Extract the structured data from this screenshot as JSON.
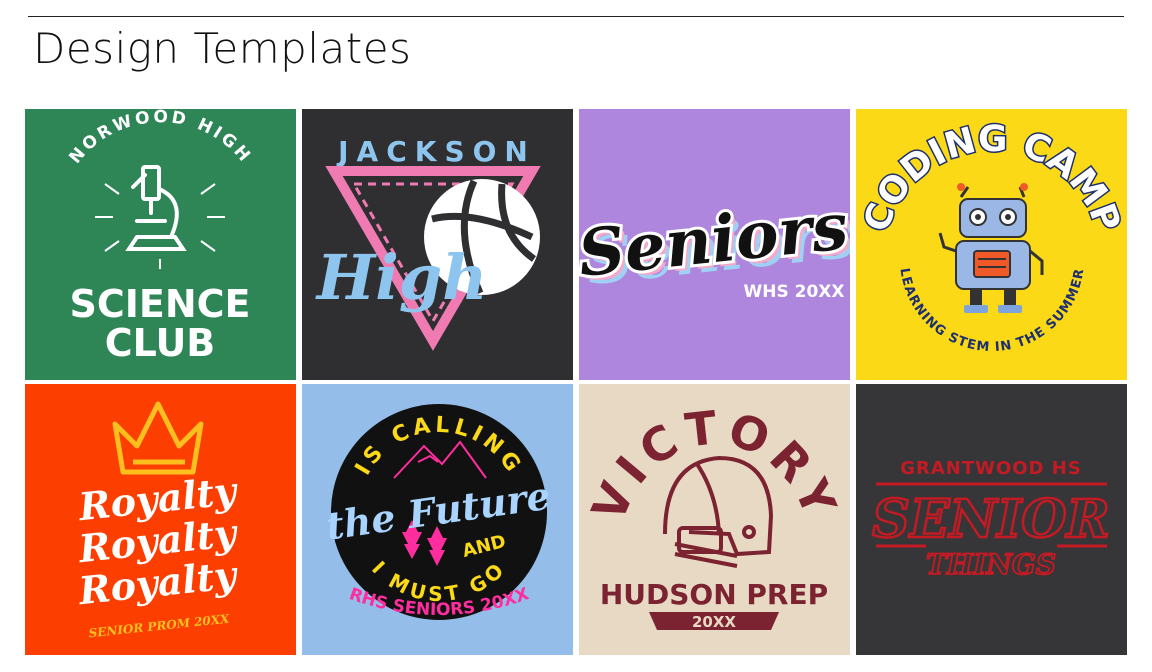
{
  "header": {
    "title": "Design Templates"
  },
  "templates": [
    {
      "name": "Science Club",
      "bg": "#2e8556",
      "arc": "NORWOOD HIGH",
      "line1": "SCIENCE",
      "line2": "CLUB"
    },
    {
      "name": "Jackson High Volleyball",
      "bg": "#2f2f31",
      "top": "JACKSON",
      "script": "High",
      "accent": "#f07bb2",
      "script_color": "#8ec5ee"
    },
    {
      "name": "Seniors",
      "bg": "#ae86dd",
      "script": "Seniors",
      "sub": "WHS 20XX"
    },
    {
      "name": "Coding Camp",
      "bg": "#fcd917",
      "arc_top": "CODING CAMP",
      "arc_bottom": "LEARNING STEM IN THE SUMMER"
    },
    {
      "name": "Royalty",
      "bg": "#fc3e00",
      "word": "Royalty",
      "sub": "SENIOR PROM 20XX",
      "accent": "#fcbf1e"
    },
    {
      "name": "The Future Is Calling",
      "bg": "#94bde9",
      "arc_top": "IS CALLING",
      "script": "the Future",
      "and": "AND",
      "arc_bottom": "I MUST GO",
      "footer": "RHS SENIORS 20XX"
    },
    {
      "name": "Victory Hudson Prep",
      "bg": "#e7d9c3",
      "arc": "VICTORY",
      "school": "HUDSON PREP",
      "year": "20XX",
      "color": "#7c2331"
    },
    {
      "name": "Senior Things",
      "bg": "#363638",
      "top": "GRANTWOOD HS",
      "big": "SENIOR",
      "small": "THINGS",
      "color": "#c41a23"
    }
  ]
}
